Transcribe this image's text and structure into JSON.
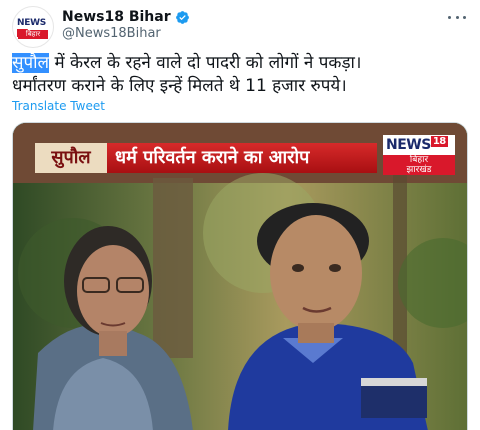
{
  "account": {
    "display_name": "News18 Bihar",
    "handle": "@News18Bihar",
    "avatar_logo_top": "NEWS",
    "avatar_logo_num": "18",
    "avatar_logo_bottom": "बिहार"
  },
  "tweet": {
    "text_highlight": "सुपौल",
    "text_line1_rest": " में केरल के रहने वाले दो पादरी को लोगों ने पकड़ा।",
    "text_line2": "धर्मांतरण कराने के लिए इन्हें मिलते थे 11 हजार रुपये।",
    "translate_label": "Translate Tweet"
  },
  "media": {
    "banner_place": "सुपौल",
    "banner_headline": "धर्म परिवर्तन कराने का आरोप",
    "channel_logo_top": "NEWS",
    "channel_logo_num": "18",
    "channel_logo_line1": "बिहार",
    "channel_logo_line2": "झारखंड"
  },
  "colors": {
    "accent": "#1d9bf0",
    "verified": "#1d9bf0",
    "selection": "#3390ff",
    "banner_red": "#c81a1e"
  },
  "icons": {
    "verified": "verified-badge-icon",
    "more": "more-options-icon"
  }
}
